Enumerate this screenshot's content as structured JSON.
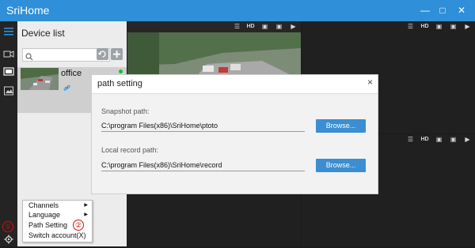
{
  "app": {
    "title": "SriHome"
  },
  "device_list": {
    "title": "Device list",
    "search_placeholder": "",
    "devices": [
      {
        "name": "office",
        "status_color": "#1fb83d"
      }
    ]
  },
  "view_toolbar": {
    "hd_label": "HD"
  },
  "context_menu": {
    "items": [
      {
        "label": "Channels",
        "has_submenu": true
      },
      {
        "label": "Language",
        "has_submenu": true
      },
      {
        "label": "Path Setting",
        "has_submenu": false
      },
      {
        "label": "Switch account(X)",
        "has_submenu": false
      }
    ]
  },
  "annotations": {
    "one": "①",
    "two": "②"
  },
  "dialog": {
    "title": "path setting",
    "close_label": "×",
    "snapshot": {
      "label": "Snapshot path:",
      "value": "C:\\program Files(x86)\\SriHome\\ptoto",
      "button": "Browse..."
    },
    "record": {
      "label": "Local record path:",
      "value": "C:\\program Files(x86)\\SriHome\\record",
      "button": "Browse..."
    }
  },
  "colors": {
    "accent": "#2f8fd8",
    "button": "#3a8ed1",
    "annotation": "#d01010"
  }
}
